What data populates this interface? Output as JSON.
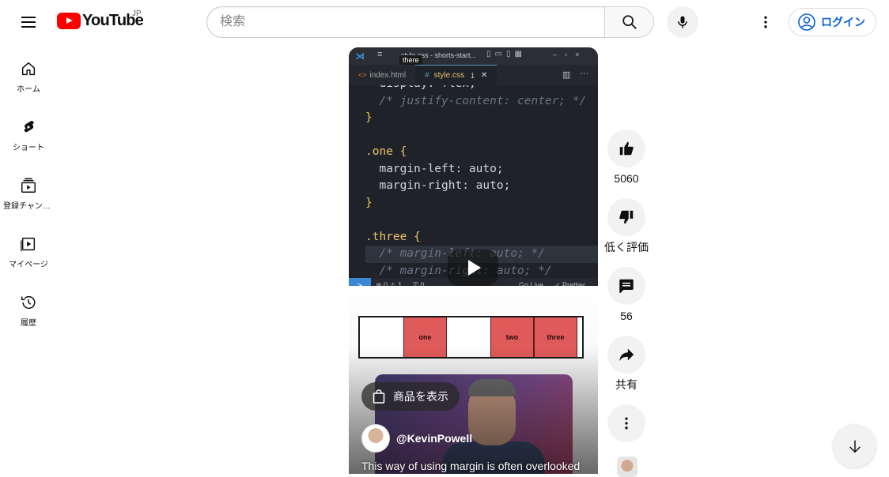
{
  "header": {
    "logo_text": "YouTube",
    "region": "JP",
    "search_placeholder": "検索",
    "login_label": "ログイン"
  },
  "sidebar": {
    "items": [
      {
        "label": "ホーム",
        "icon": "home-icon"
      },
      {
        "label": "ショート",
        "icon": "shorts-icon"
      },
      {
        "label": "登録チャンネル",
        "icon": "subscriptions-icon"
      },
      {
        "label": "マイページ",
        "icon": "library-icon"
      },
      {
        "label": "履歴",
        "icon": "history-icon"
      }
    ]
  },
  "video": {
    "editor_title": "style.css - shorts-start...",
    "tooltip": "there",
    "tabs": [
      {
        "label": "index.html"
      },
      {
        "label": "style.css",
        "badge": "1"
      }
    ],
    "code_lines": [
      "  display: flex;",
      "  /* justify-content: center; */",
      "}",
      "",
      ".one {",
      "  margin-left: auto;",
      "  margin-right: auto;",
      "}",
      "",
      ".three {",
      "  /* margin-left: auto; */",
      "  /* margin-right: auto; */"
    ],
    "status": {
      "errors": "⊗ 0 ⚠ 1",
      "ports": "⚿ 0",
      "golive": "Go Live",
      "prettier": "✓ Prettier"
    },
    "demo_boxes": [
      "",
      "one",
      "",
      "two",
      "three"
    ],
    "products_label": "商品を表示",
    "channel": "@KevinPowell",
    "title": "This way of using margin is often overlooked"
  },
  "actions": {
    "like_count": "5060",
    "dislike_label": "低く評価",
    "comment_count": "56",
    "share_label": "共有"
  },
  "colors": {
    "brand_red": "#ff0000",
    "link_blue": "#065fd4",
    "demo_red": "#df5a5a"
  }
}
